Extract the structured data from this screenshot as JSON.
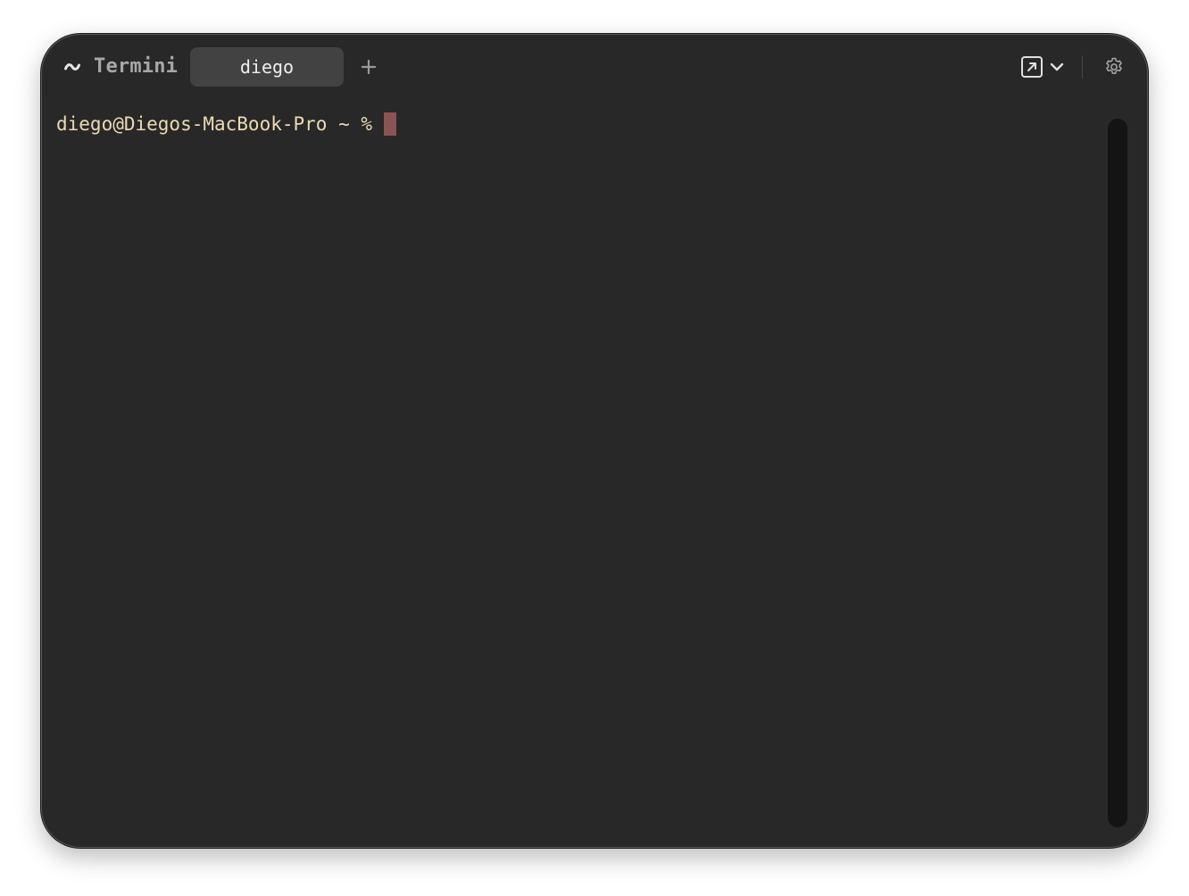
{
  "app": {
    "logo_glyph": "~",
    "title": "Termini"
  },
  "tabs": [
    {
      "label": "diego",
      "active": true
    }
  ],
  "toolbar": {
    "new_tab_icon": "plus-icon",
    "popout_icon": "arrow-up-right-square-icon",
    "dropdown_icon": "chevron-down-icon",
    "settings_icon": "gear-icon"
  },
  "terminal": {
    "prompt": "diego@Diegos-MacBook-Pro ~ %",
    "input": "",
    "text_color": "#ebdbb2",
    "cursor_color": "#8a5455",
    "background": "#282828"
  }
}
